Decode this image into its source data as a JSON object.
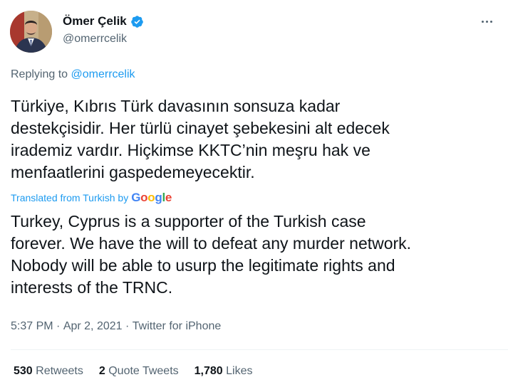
{
  "author": {
    "display_name": "Ömer Çelik",
    "handle": "@omerrcelik",
    "verified": true,
    "verified_color": "#1d9bf0"
  },
  "reply": {
    "prefix": "Replying to",
    "target": "@omerrcelik"
  },
  "tweet": {
    "original_text": "Türkiye, Kıbrıs Türk davasının sonsuza kadar\ndestekçisidir. Her türlü cinayet şebekesini alt edecek\nirademiz vardır. Hiçkimse KKTC’nin meşru hak ve\nmenfaatlerini gaspedemeyecektir.",
    "translation_credit": "Translated from Turkish by",
    "translation_provider": "Google",
    "translated_text": "Turkey, Cyprus is a supporter of the Turkish case\nforever. We have the will to defeat any murder network.\nNobody will be able to usurp the legitimate rights and\ninterests of the TRNC."
  },
  "meta": {
    "time": "5:37 PM",
    "separator": " · ",
    "date": "Apr 2, 2021",
    "source": "Twitter for iPhone"
  },
  "stats": {
    "retweets_count": "530",
    "retweets_label": "Retweets",
    "quotes_count": "2",
    "quotes_label": "Quote Tweets",
    "likes_count": "1,780",
    "likes_label": "Likes"
  },
  "colors": {
    "accent": "#1d9bf0",
    "secondary_text": "#536471",
    "primary_text": "#0f1419"
  },
  "icons": [
    "avatar",
    "verified-badge-icon",
    "more-icon"
  ]
}
